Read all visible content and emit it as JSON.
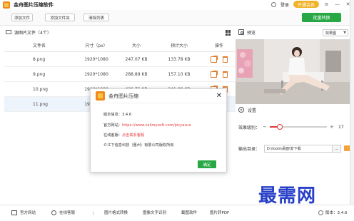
{
  "app": {
    "title": "金舟图片压缩软件",
    "login": "登录",
    "vip": "开通会员"
  },
  "toolbar": {
    "add_file": "添加文件",
    "add_folder": "添加文件夹",
    "clear_list": "清除列表",
    "batch_convert": "批量转换"
  },
  "file_list": {
    "title": "源图片文件（4个）",
    "columns": [
      "文件名",
      "尺寸（px）",
      "大小",
      "预计大小",
      "操作"
    ],
    "rows": [
      {
        "name": "8.png",
        "dims": "1920*1080",
        "size": "247.07 KB",
        "est": "133.78 KB"
      },
      {
        "name": "9.png",
        "dims": "1920*1080",
        "size": "288.89 KB",
        "est": "157.10 KB"
      },
      {
        "name": "10.png",
        "dims": "1920*1080",
        "size": "426.75 KB",
        "est": "241.99 KB"
      },
      {
        "name": "11.png",
        "dims": "1920*1080",
        "size": "",
        "est": ""
      }
    ]
  },
  "preview": {
    "label": "预览",
    "mode": "效果图"
  },
  "settings": {
    "label": "设置",
    "effect_label": "效果级别：",
    "effect_value": "17",
    "effect_level": 0.17,
    "output_label": "输出目录：",
    "output_path": "D:\\tools\\桌面\\安下载",
    "browse": "..."
  },
  "dialog": {
    "title": "金舟图片压缩",
    "version": "版本信息：3.4.6",
    "site_prefix": "官方网站：",
    "site_url": "https://www.callmysoft.com/picyasuo",
    "support_prefix": "在线客服：",
    "support_link": "点击联系客服",
    "copyright": "©江下信息科技（惠州）有限公司版权所有",
    "ok": "确定",
    "close": "✕"
  },
  "footer": {
    "site": "官方网站",
    "support": "在线客服",
    "links": [
      "图片格式转换",
      "图像文字识别",
      "截图软件",
      "图片转PDF"
    ],
    "version": "版本：3.4.6"
  },
  "watermark": "最需网",
  "colors": {
    "accent_green": "#27a844",
    "accent_orange": "#f08a1a",
    "slider_red": "#e23b3b",
    "selected_row": "#eef4fc"
  }
}
